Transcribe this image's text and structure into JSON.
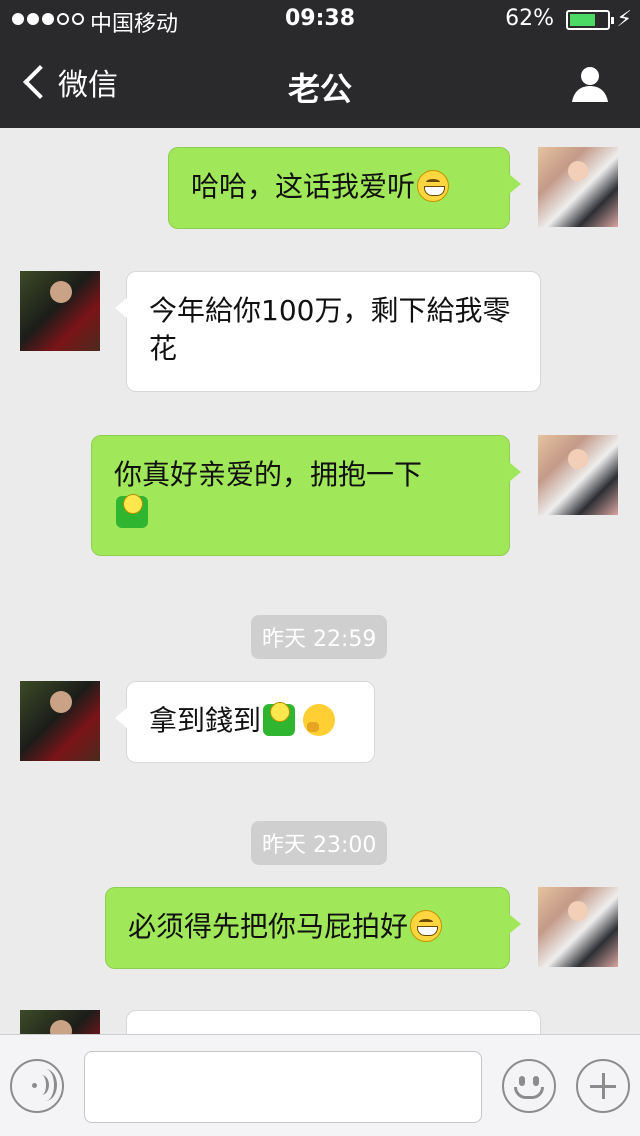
{
  "status_bar": {
    "carrier": "中国移动",
    "time": "09:38",
    "battery_percent": "62%",
    "battery_level": 0.62,
    "signal_bars_filled": 3,
    "signal_bars_total": 5
  },
  "nav": {
    "back_label": "微信",
    "title": "老公",
    "profile_icon": "person-icon"
  },
  "messages": [
    {
      "side": "out",
      "text": "哈哈，这话我爱听",
      "emoji": [
        "grin-emoji"
      ]
    },
    {
      "side": "in",
      "text": "今年給你100万，剩下給我零花",
      "emoji": []
    },
    {
      "side": "out",
      "text": "你真好亲爱的，拥抱一下",
      "emoji": [
        "hug-emoji"
      ]
    },
    {
      "type": "time",
      "text": "昨天 22:59"
    },
    {
      "side": "in",
      "text": "拿到錢到",
      "emoji": [
        "hug-emoji",
        "thinking-emoji"
      ]
    },
    {
      "type": "time",
      "text": "昨天 23:00"
    },
    {
      "side": "out",
      "text": "必须得先把你马屁拍好",
      "emoji": [
        "grin-emoji"
      ]
    }
  ],
  "input_bar": {
    "voice_icon": "voice-icon",
    "input_value": "",
    "emoji_icon": "emoji-icon",
    "plus_icon": "plus-icon"
  },
  "colors": {
    "outgoing_bubble": "#a0e75a",
    "incoming_bubble": "#ffffff",
    "nav_bg": "#2a2a2d",
    "chat_bg": "#ebebeb"
  }
}
